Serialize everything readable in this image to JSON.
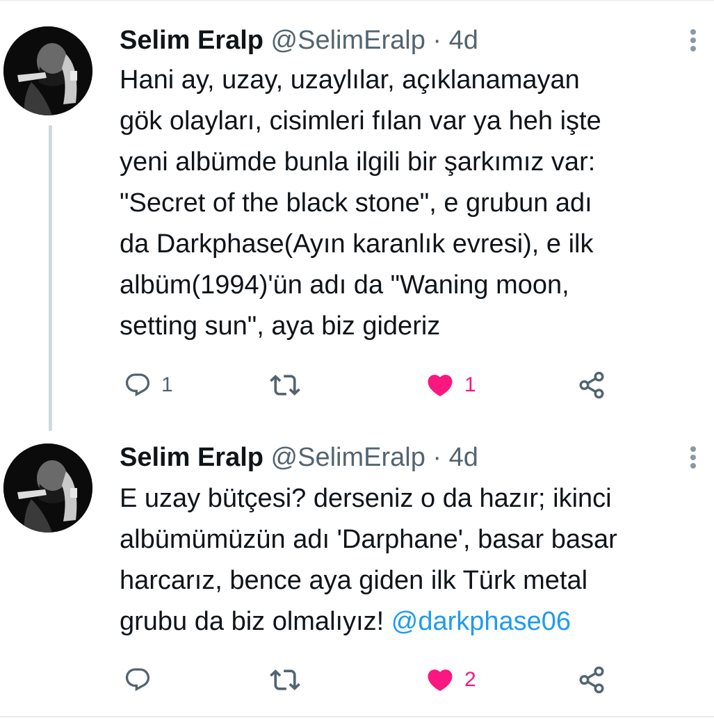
{
  "tweets": [
    {
      "author_name": "Selim Eralp",
      "handle": "@SelimEralp",
      "separator": "·",
      "time": "4d",
      "text": "Hani ay, uzay, uzaylılar, açıklanamayan\ngök olayları, cisimleri  fılan var ya heh işte\nyeni albümde bunla ilgili bir şarkımız var:\n\"Secret of the black stone\", e grubun adı\nda Darkphase(Ayın karanlık evresi), e ilk\nalbüm(1994)'ün adı da \"Waning moon,\nsetting sun\", aya biz gideriz",
      "reply_count": "1",
      "retweet_count": "",
      "like_count": "1",
      "liked": true
    },
    {
      "author_name": "Selim Eralp",
      "handle": "@SelimEralp",
      "separator": "·",
      "time": "4d",
      "text": "E uzay bütçesi? derseniz o da hazır; ikinci\nalbümümüzün adı 'Darphane', basar basar\nharcarız, bence aya giden ilk Türk metal\ngrubu da biz olmalıyız! ",
      "mention": "@darkphase06",
      "reply_count": "",
      "retweet_count": "",
      "like_count": "2",
      "liked": true
    }
  ],
  "icons": {
    "reply": "reply-icon",
    "retweet": "retweet-icon",
    "like": "heart-icon",
    "share": "share-icon",
    "more": "more-options-icon"
  },
  "colors": {
    "text": "#0f1419",
    "secondary": "#536471",
    "like": "#f91880",
    "mention": "#1d9bf0",
    "icon": "#536471"
  }
}
